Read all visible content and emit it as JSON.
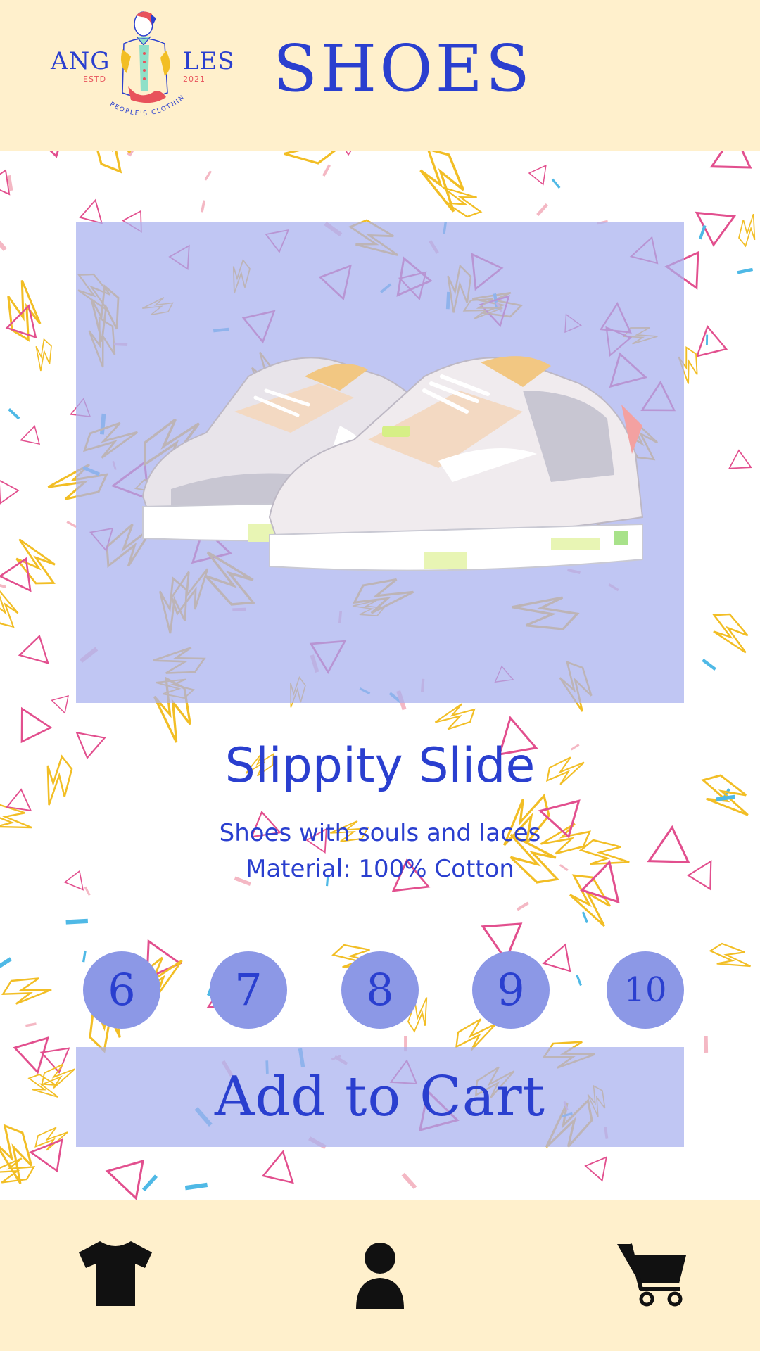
{
  "header": {
    "logo": {
      "left_text": "ANG",
      "right_text": "LES",
      "estd": "ESTD",
      "year": "2021",
      "caption": "PEOPLE'S CLOTHING"
    },
    "title": "SHOES"
  },
  "product": {
    "name": "Slippity Slide",
    "description": "Shoes with souls and laces",
    "material": "Material: 100% Cotton",
    "image_icon": "sneaker-pair-icon"
  },
  "sizes": [
    "6",
    "7",
    "8",
    "9",
    "10"
  ],
  "cart": {
    "label": "Add to Cart"
  },
  "nav": [
    {
      "name": "shop",
      "icon": "tshirt-icon"
    },
    {
      "name": "profile",
      "icon": "person-icon"
    },
    {
      "name": "cart",
      "icon": "cart-icon"
    }
  ],
  "colors": {
    "accent": "#2a3fcf",
    "header_bg": "#fff0cc",
    "card_bg": "#a8b0ee",
    "size_bg": "#8c98e6",
    "pattern_yellow": "#f2be25",
    "pattern_pink": "#e24f8e",
    "pattern_blue": "#4fb9e6"
  }
}
